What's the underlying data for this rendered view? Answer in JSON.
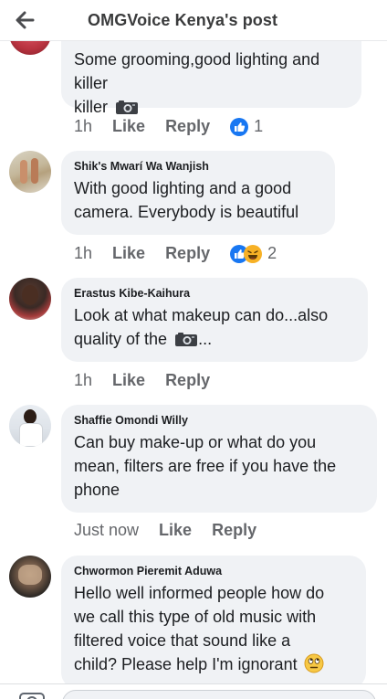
{
  "header": {
    "title": "OMGVoice Kenya's post",
    "back_icon": "back-arrow-icon"
  },
  "colors": {
    "bubble_bg": "#f0f2f5",
    "meta_text": "#65676b",
    "like_blue": "#1877f2",
    "haha_yellow": "#f7b125"
  },
  "comments": [
    {
      "author": "",
      "text": "Some grooming,good lighting and killer",
      "trailing_icon": "camera-icon",
      "time": "1h",
      "like_label": "Like",
      "reply_label": "Reply",
      "reactions": [
        "like"
      ],
      "reaction_count": "1"
    },
    {
      "author": "Shik's Mwarí Wa Wanjish",
      "text_line1": "With good lighting and a good",
      "text_line2": "camera. Everybody is beautiful",
      "time": "1h",
      "like_label": "Like",
      "reply_label": "Reply",
      "reactions": [
        "like",
        "haha"
      ],
      "reaction_count": "2"
    },
    {
      "author": "Erastus Kibe-Kaihura",
      "text_line1": "Look at what makeup can do...also",
      "text_line2_before": "quality of the",
      "text_line2_after": "...",
      "trailing_icon": "camera-icon",
      "time": "1h",
      "like_label": "Like",
      "reply_label": "Reply"
    },
    {
      "author": "Shaffie Omondi Willy",
      "text_line1": "Can buy make-up or what do you",
      "text_line2": "mean, filters are free if you have the",
      "text_line3": "phone",
      "time": "Just now",
      "like_label": "Like",
      "reply_label": "Reply"
    },
    {
      "author": "Chwormon Pieremit Aduwa",
      "text_line1": "Hello well informed people how do",
      "text_line2": "we call this type of old music with",
      "text_line3": "filtered voice that sound like a",
      "text_line4": "child? Please help I'm ignorant",
      "trailing_icon": "rolling-eyes-emoji-icon"
    }
  ],
  "composer": {
    "placeholder": ""
  }
}
